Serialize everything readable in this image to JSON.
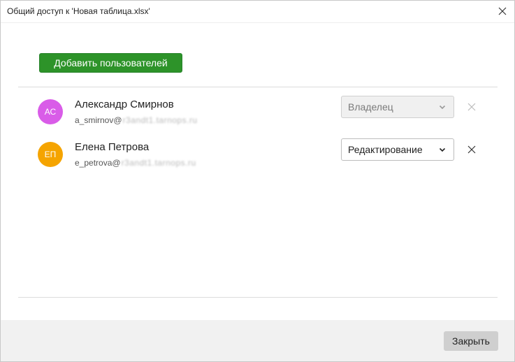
{
  "window": {
    "title": "Общий доступ к 'Новая таблица.xlsx'"
  },
  "actions": {
    "add_users_label": "Добавить пользователей",
    "close_label": "Закрыть"
  },
  "users": [
    {
      "initials": "АС",
      "name": "Александр Смирнов",
      "email_local": "a_smirnov@",
      "email_domain_blurred": "r3andt1.tarnops.ru",
      "role": "Владелец",
      "role_editable": false,
      "avatar_color": "#d95ce8"
    },
    {
      "initials": "ЕП",
      "name": "Елена Петрова",
      "email_local": "e_petrova@",
      "email_domain_blurred": "r3andt1.tarnops.ru",
      "role": "Редактирование",
      "role_editable": true,
      "avatar_color": "#f5a400"
    }
  ],
  "colors": {
    "accent_green": "#2d9329",
    "footer_bg": "#f1f1f1"
  }
}
